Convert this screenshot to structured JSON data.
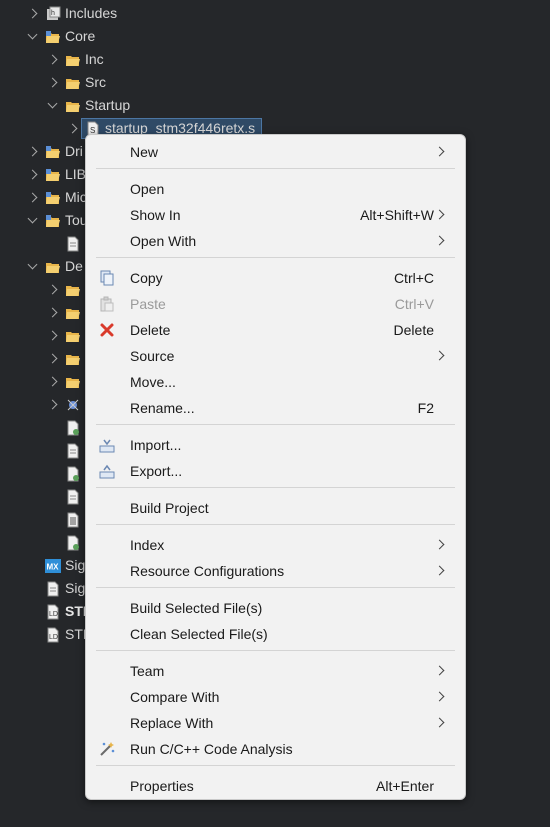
{
  "tree": [
    {
      "label": "Includes",
      "state": "closed",
      "icon": "includes-icon"
    },
    {
      "label": "Core",
      "state": "open",
      "icon": "source-folder-icon"
    },
    {
      "label": "Inc",
      "state": "closed",
      "icon": "folder-icon"
    },
    {
      "label": "Src",
      "state": "closed",
      "icon": "folder-icon"
    },
    {
      "label": "Startup",
      "state": "open",
      "icon": "folder-icon"
    },
    {
      "label": "startup_stm32f446retx.s",
      "state": "closed",
      "icon": "asm-file-icon"
    },
    {
      "label": "Dri",
      "state": "closed",
      "icon": "source-folder-icon"
    },
    {
      "label": "LIB",
      "state": "closed",
      "icon": "source-folder-icon"
    },
    {
      "label": "Mic",
      "state": "closed",
      "icon": "source-folder-icon"
    },
    {
      "label": "Tou",
      "state": "open",
      "icon": "source-folder-icon"
    },
    {
      "label": "",
      "state": "none",
      "icon": "file-icon"
    },
    {
      "label": "De",
      "state": "open",
      "icon": "folder-icon"
    },
    {
      "label": "",
      "state": "closed",
      "icon": "folder-icon"
    },
    {
      "label": "",
      "state": "closed",
      "icon": "folder-icon"
    },
    {
      "label": "",
      "state": "closed",
      "icon": "folder-icon"
    },
    {
      "label": "",
      "state": "closed",
      "icon": "folder-icon"
    },
    {
      "label": "",
      "state": "closed",
      "icon": "folder-icon"
    },
    {
      "label": "",
      "state": "closed",
      "icon": "binary-icon"
    },
    {
      "label": "",
      "state": "none",
      "icon": "object-file-icon"
    },
    {
      "label": "",
      "state": "none",
      "icon": "file-icon"
    },
    {
      "label": "",
      "state": "none",
      "icon": "object-file-icon"
    },
    {
      "label": "",
      "state": "none",
      "icon": "file-icon"
    },
    {
      "label": "",
      "state": "none",
      "icon": "text-file-icon"
    },
    {
      "label": "",
      "state": "none",
      "icon": "object-file-icon"
    },
    {
      "label": "Sig",
      "state": "none",
      "icon": "mx-icon"
    },
    {
      "label": "Sig",
      "state": "none",
      "icon": "file-icon"
    },
    {
      "label": "STI",
      "state": "none",
      "icon": "linker-file-icon",
      "bold": true
    },
    {
      "label": "STN",
      "state": "none",
      "icon": "linker-file-icon"
    }
  ],
  "menu": {
    "new": "New",
    "open": "Open",
    "show_in": "Show In",
    "show_in_key": "Alt+Shift+W",
    "open_with": "Open With",
    "copy": "Copy",
    "copy_key": "Ctrl+C",
    "paste": "Paste",
    "paste_key": "Ctrl+V",
    "delete": "Delete",
    "delete_key": "Delete",
    "source": "Source",
    "move": "Move...",
    "rename": "Rename...",
    "rename_key": "F2",
    "import": "Import...",
    "export": "Export...",
    "build_project": "Build Project",
    "index": "Index",
    "resource_configurations": "Resource Configurations",
    "build_selected": "Build Selected File(s)",
    "clean_selected": "Clean Selected File(s)",
    "team": "Team",
    "compare_with": "Compare With",
    "replace_with": "Replace With",
    "run_analysis": "Run C/C++ Code Analysis",
    "properties": "Properties",
    "properties_key": "Alt+Enter"
  },
  "colors": {
    "background": "#25272a",
    "menu_bg": "#f2f2f2",
    "selection": "#2f4a66",
    "folder": "#e8b54a",
    "delete_red": "#d93a2b"
  }
}
